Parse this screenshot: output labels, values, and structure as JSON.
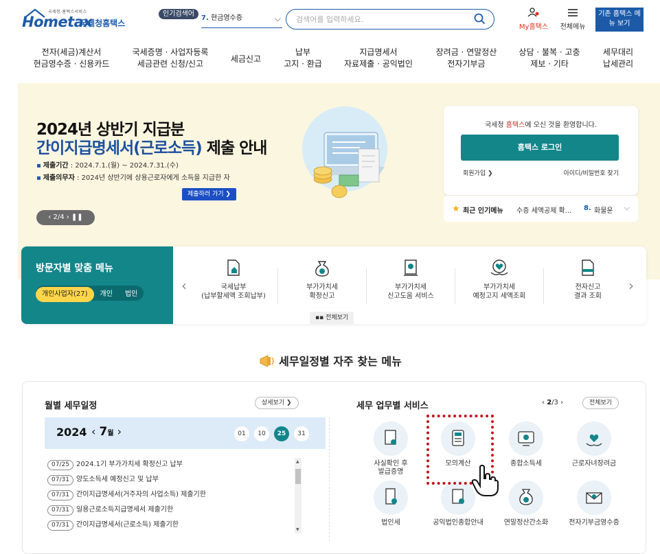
{
  "header": {
    "logo_small": "국세청 홈택스서비스",
    "logo_main": "Hometax",
    "logo_sub": "국세청홈택스",
    "popular_badge": "인기검색어",
    "popular_num": "7.",
    "popular_value": "현금영수증",
    "search_placeholder": "검색어를 입력하세요.",
    "my_hometax": "My홈택스",
    "all_menu": "전체메뉴",
    "old_menu": "기존 홈택스 메뉴 보기"
  },
  "gnb": [
    {
      "line1": "전자(세금)계산서",
      "line2": "현금영수증 · 신용카드"
    },
    {
      "line1": "국세증명 · 사업자등록",
      "line2": "세금관련 신청/신고"
    },
    {
      "line1": "세금신고",
      "line2": ""
    },
    {
      "line1": "납부",
      "line2": "고지 · 환급"
    },
    {
      "line1": "지급명세서",
      "line2": "자료제출 · 공익법인"
    },
    {
      "line1": "장려금 · 연말정산",
      "line2": "전자기부금"
    },
    {
      "line1": "상담 · 불복 · 고충",
      "line2": "제보 · 기타"
    },
    {
      "line1": "세무대리",
      "line2": "납세관리"
    }
  ],
  "hero": {
    "title1": "2024년 상반기 지급분",
    "title2_hl": "간이지급명세서(근로소득)",
    "title2_rest": " 제출 안내",
    "line1_label": "제출기간",
    "line1_value": " : 2024.7.1.(월) ~ 2024.7.31.(수)",
    "line2_label": "제출의무자",
    "line2_value": " : 2024년 상반기에 상용근로자에게 소득을 지급한 자",
    "button": "제출하러 가기 ❯",
    "pager": "‹  2/4  ›   ❚❚"
  },
  "login": {
    "welcome_pre": "국세청 ",
    "welcome_hl": "홈택스",
    "welcome_post": "에 오신 것을 환영합니다.",
    "button": "홈택스 로그인",
    "join": "회원가입 ❯",
    "find": "아이디/비밀번호 찾기"
  },
  "recent": {
    "label": "최근 인기메뉴",
    "value1": "수증 세액공제 확...",
    "num": "8.",
    "value2": "화물운"
  },
  "visitor": {
    "title": "방문자별 맞춤 메뉴",
    "tabs": [
      "개인사업자(27)",
      "개인",
      "법인"
    ],
    "items": [
      {
        "line1": "국세납부",
        "line2": "(납부할세액 조회납부)"
      },
      {
        "line1": "부가가치세",
        "line2": "확정신고"
      },
      {
        "line1": "부가가치세",
        "line2": "신고도움 서비스"
      },
      {
        "line1": "부가가치세",
        "line2": "예정고지 세액조회"
      },
      {
        "line1": "전자신고",
        "line2": "결과 조회"
      }
    ],
    "view_all": "전체보기"
  },
  "section_title": "세무일정별 자주 찾는 메뉴",
  "calendar": {
    "title": "월별 세무일정",
    "more": "상세보기 ❯",
    "year": "2024",
    "month": "7",
    "month_unit": "월",
    "days": [
      "01",
      "10",
      "25",
      "31"
    ],
    "active_day": "25",
    "schedule": [
      {
        "date": "07/25",
        "text": "2024.1기 부가가치세 확정신고 납부"
      },
      {
        "date": "07/31",
        "text": "양도소득세 예정신고 및 납부"
      },
      {
        "date": "07/31",
        "text": "간이지급명세서(거주자의 사업소득) 제출기한"
      },
      {
        "date": "07/31",
        "text": "일용근로소득지급명세서 제출기한"
      },
      {
        "date": "07/31",
        "text": "간이지급명세서(근로소득) 제출기한"
      }
    ]
  },
  "services": {
    "title": "세무 업무별 서비스",
    "page": "2",
    "total": "/3",
    "view_all": "전체보기",
    "items": [
      {
        "label": "사실확인 후\n발급증명"
      },
      {
        "label": "모의계산"
      },
      {
        "label": "종합소득세"
      },
      {
        "label": "근로자녀장려금"
      },
      {
        "label": "법인세"
      },
      {
        "label": "공익법인종합안내"
      },
      {
        "label": "연말정산간소화"
      },
      {
        "label": "전자기부금영수증"
      }
    ]
  },
  "colors": {
    "brand_blue": "#1c5aa8",
    "teal": "#13868a",
    "hero_bg": "#fbf6e0",
    "highlight_red": "#c0121a"
  }
}
